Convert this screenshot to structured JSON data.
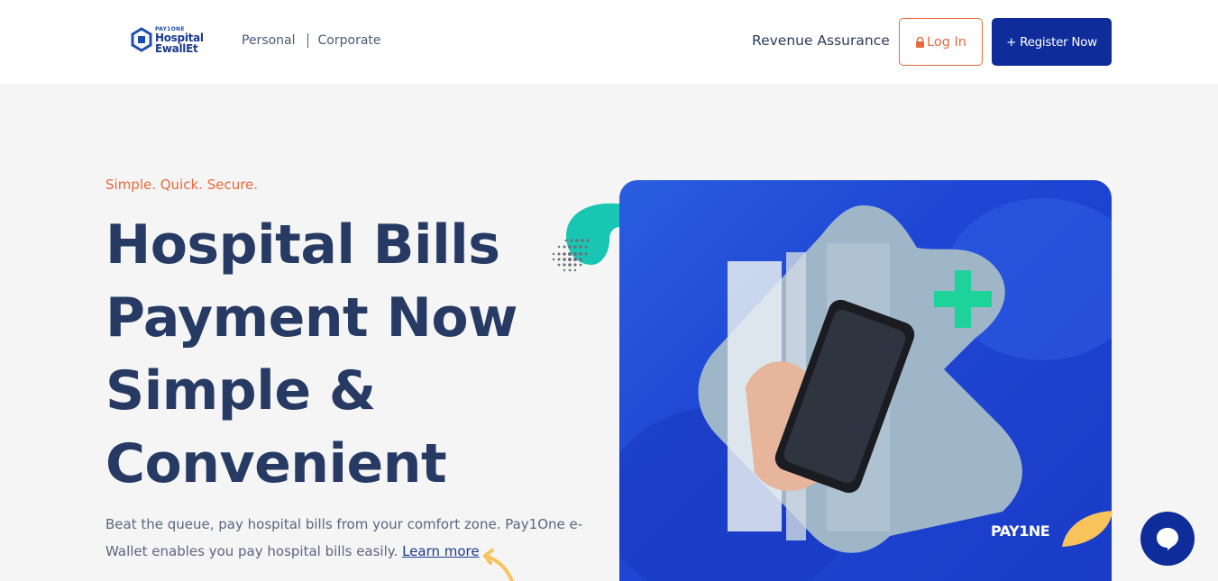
{
  "header": {
    "logo": {
      "small": "PAY1ONE",
      "line1": "Hospital",
      "line2": "EwallEt"
    },
    "nav": [
      {
        "label": "Personal"
      },
      {
        "label": "Corporate"
      }
    ],
    "revenue_label": "Revenue Assurance",
    "login_label": "Log In",
    "register_label": "+ Register Now"
  },
  "hero": {
    "tagline": "Simple. Quick. Secure.",
    "title_lines": [
      "Hospital Bills",
      "Payment Now",
      "Simple &",
      "Convenient"
    ],
    "description": "Beat the queue, pay hospital bills from your comfort zone. Pay1One e-Wallet enables you pay hospital bills easily.",
    "learn_more": "Learn more",
    "badge": "PAY1NE"
  },
  "colors": {
    "primary": "#0f2d9a",
    "accent": "#e8693a",
    "heading": "#263a63",
    "teal": "#19c6b3",
    "yellow": "#f8c35a"
  }
}
